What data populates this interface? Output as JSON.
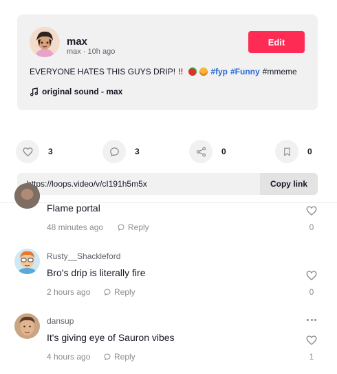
{
  "post": {
    "author_name": "max",
    "author_meta": "max · 10h ago",
    "edit_label": "Edit",
    "caption": {
      "text": "EVERYONE HATES THIS GUYS DRIP!",
      "bang": "‼",
      "emoji_icons": [
        "pepper-emoji-icon",
        "grimace-emoji-icon"
      ],
      "hashtags": [
        "#fyp",
        "#Funny",
        "#mmeme"
      ]
    },
    "sound": "original sound - max"
  },
  "actions": {
    "likes": "3",
    "comments": "3",
    "shares": "0",
    "bookmarks": "0"
  },
  "share_link": {
    "url": "https://loops.video/v/cI191h5m5x",
    "copy_label": "Copy link"
  },
  "comments": [
    {
      "username": "",
      "text": "Flame portal",
      "time": "48 minutes ago",
      "reply_label": "Reply",
      "likes": "0"
    },
    {
      "username": "Rusty__Shackleford",
      "text": "Bro's drip is literally fire",
      "time": "2 hours ago",
      "reply_label": "Reply",
      "likes": "0"
    },
    {
      "username": "dansup",
      "text": "It's giving eye of Sauron vibes",
      "time": "4 hours ago",
      "reply_label": "Reply",
      "likes": "1"
    }
  ],
  "colors": {
    "accent": "#fe2c55",
    "hashtag": "#2b6cd6",
    "card_bg": "#f1f1f2",
    "muted": "#8a8b91"
  }
}
